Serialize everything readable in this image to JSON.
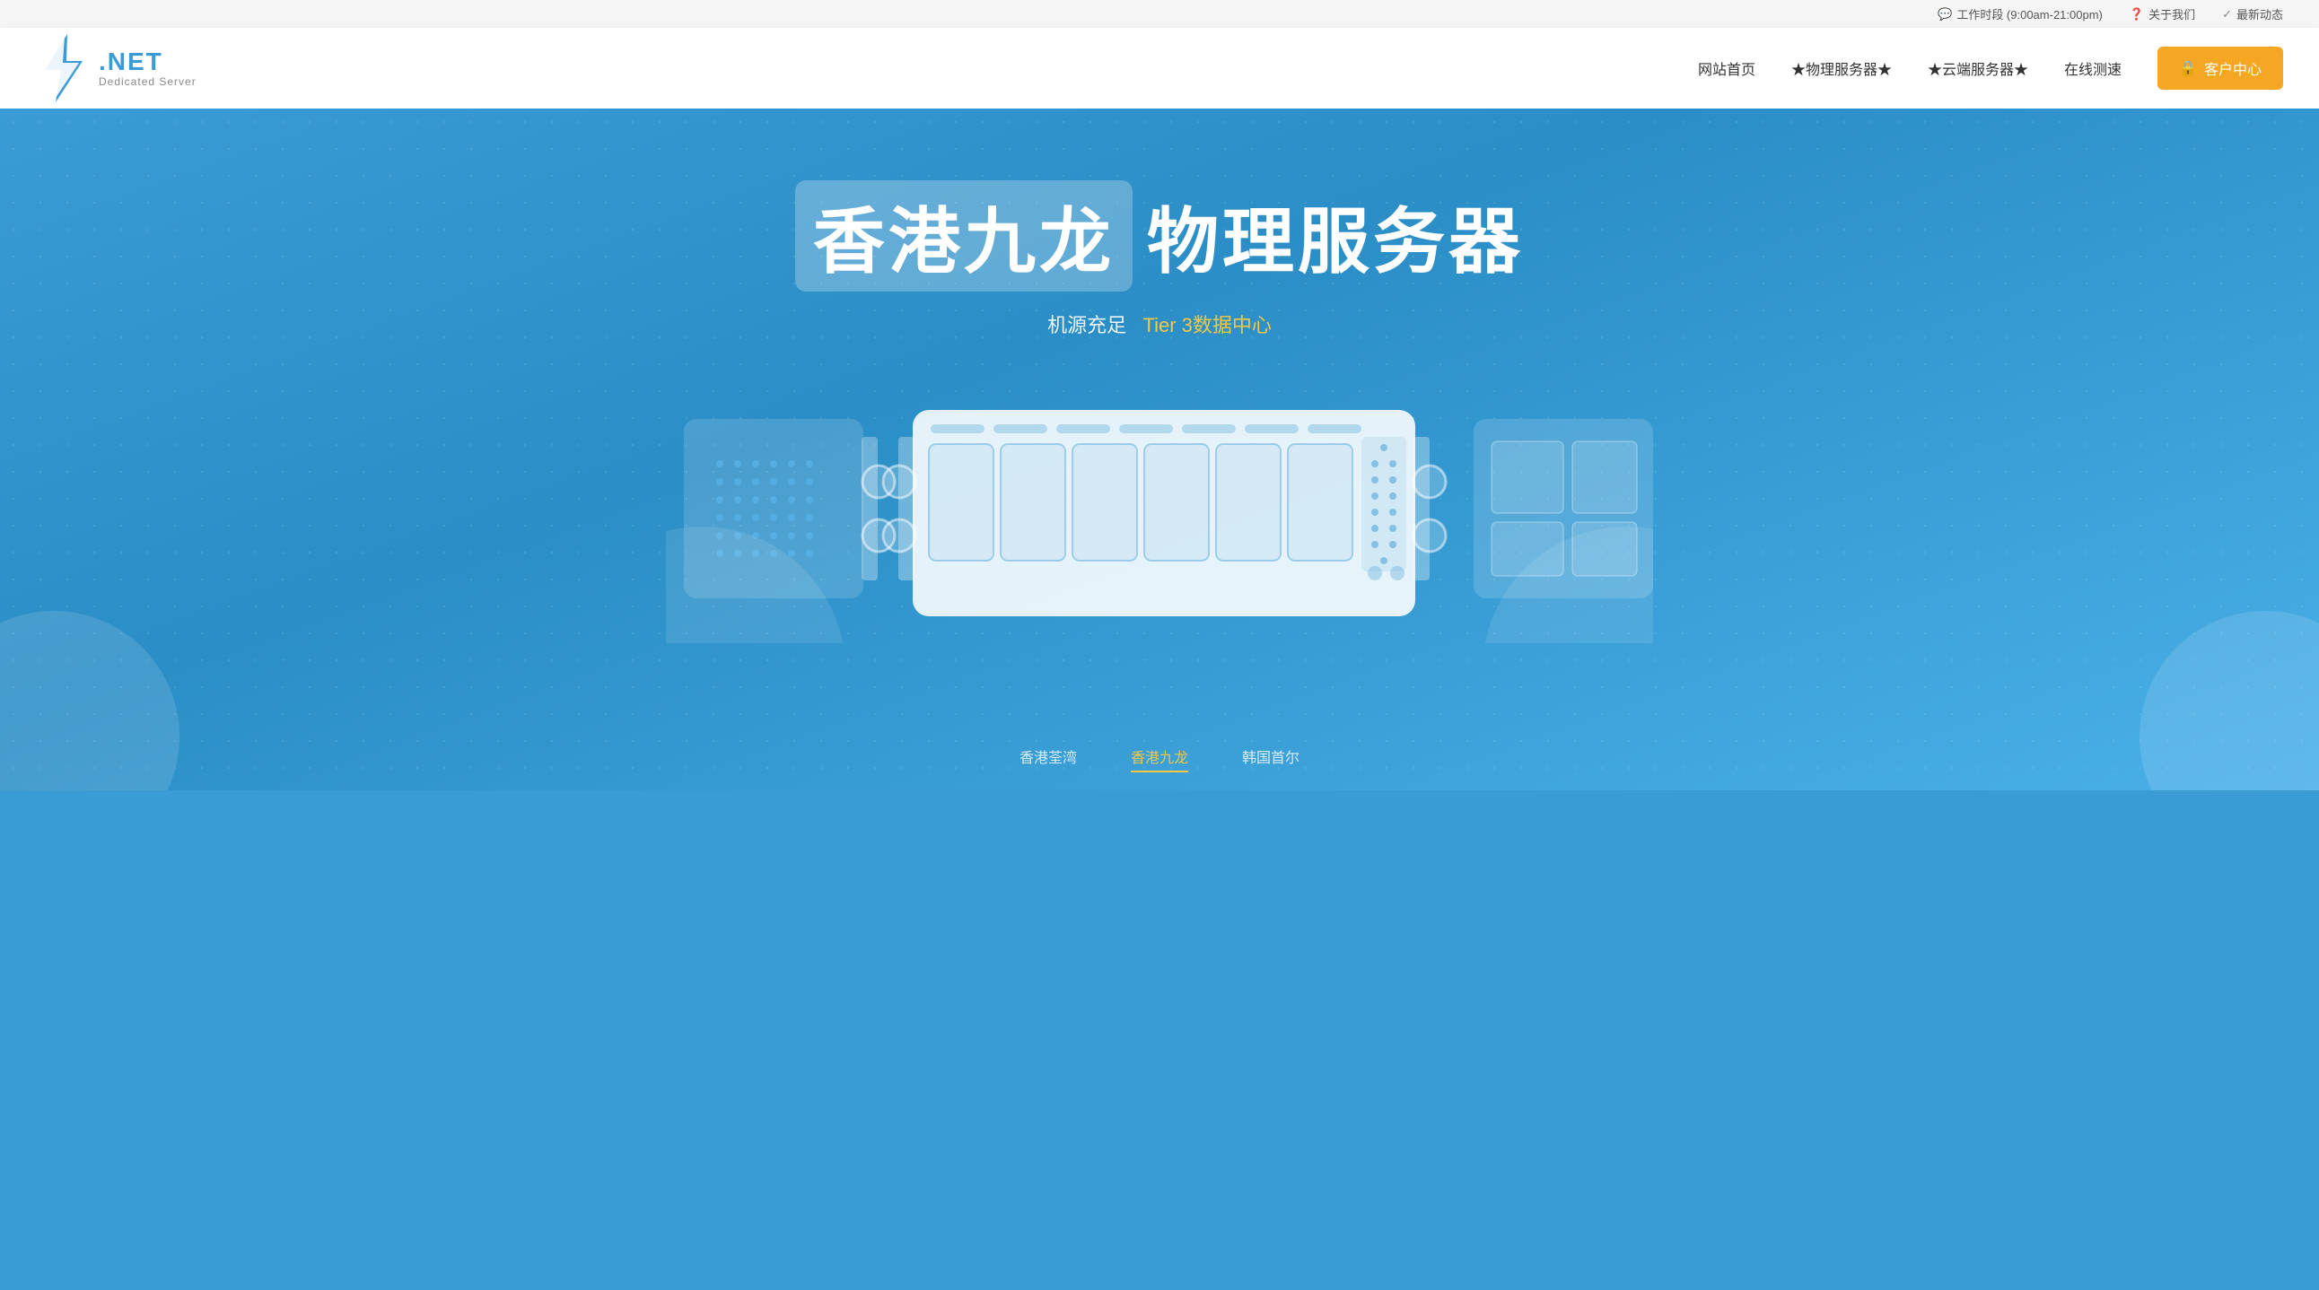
{
  "topbar": {
    "working_hours_icon": "💬",
    "working_hours_label": "工作时段 (9:00am-21:00pm)",
    "about_icon": "❓",
    "about_label": "关于我们",
    "news_icon": "✓",
    "news_label": "最新动态"
  },
  "header": {
    "logo_net": ".NET",
    "logo_sub": "Dedicated Server",
    "nav": {
      "home": "网站首页",
      "physical": "★物理服务器★",
      "cloud": "★云端服务器★",
      "speed_test": "在线测速",
      "client_center": "客户中心"
    }
  },
  "hero": {
    "title_part1": "香港九龙",
    "title_part2": "物理服务器",
    "subtitle_normal": "机源充足",
    "subtitle_accent": "Tier 3数据中心"
  },
  "locations": {
    "tabs": [
      {
        "label": "香港荃湾",
        "active": false
      },
      {
        "label": "香港九龙",
        "active": true
      },
      {
        "label": "韩国首尔",
        "active": false
      }
    ]
  }
}
